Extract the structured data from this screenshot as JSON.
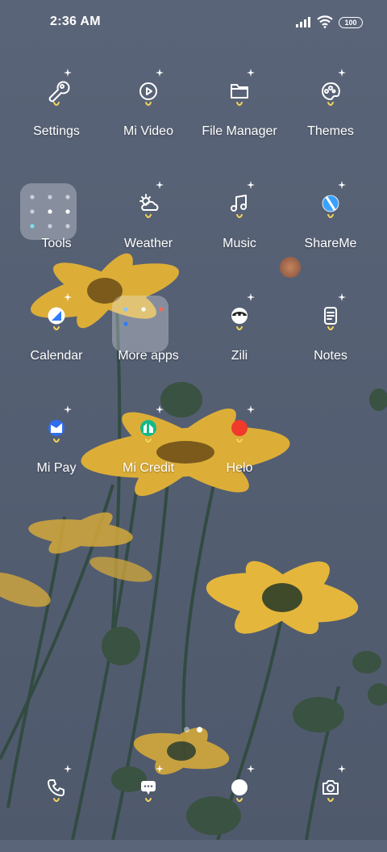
{
  "status_bar": {
    "time": "2:36 AM",
    "battery": "100"
  },
  "apps": [
    {
      "label": "Settings",
      "icon": "gear-wrench-icon"
    },
    {
      "label": "Mi Video",
      "icon": "play-circle-icon"
    },
    {
      "label": "File Manager",
      "icon": "folder-icon"
    },
    {
      "label": "Themes",
      "icon": "palette-icon"
    },
    {
      "label": "Tools",
      "icon": "folder-icon"
    },
    {
      "label": "Weather",
      "icon": "weather-icon"
    },
    {
      "label": "Music",
      "icon": "music-note-icon"
    },
    {
      "label": "ShareMe",
      "icon": "shareme-icon"
    },
    {
      "label": "Calendar",
      "icon": "calendar-icon"
    },
    {
      "label": "More apps",
      "icon": "folder-icon"
    },
    {
      "label": "Zili",
      "icon": "zili-icon"
    },
    {
      "label": "Notes",
      "icon": "notes-icon"
    },
    {
      "label": "Mi Pay",
      "icon": "mi-pay-icon"
    },
    {
      "label": "Mi Credit",
      "icon": "mi-credit-icon"
    },
    {
      "label": "Helo",
      "icon": "helo-icon"
    }
  ],
  "dock": [
    {
      "icon": "phone-icon"
    },
    {
      "icon": "messages-icon"
    },
    {
      "icon": "browser-icon"
    },
    {
      "icon": "camera-icon"
    }
  ],
  "page_indicator": {
    "pages": 2,
    "current": 2
  },
  "colors": {
    "accent_yellow": "#f1d35a",
    "wallpaper": "#5b6579",
    "flower": "#e2b43a"
  }
}
